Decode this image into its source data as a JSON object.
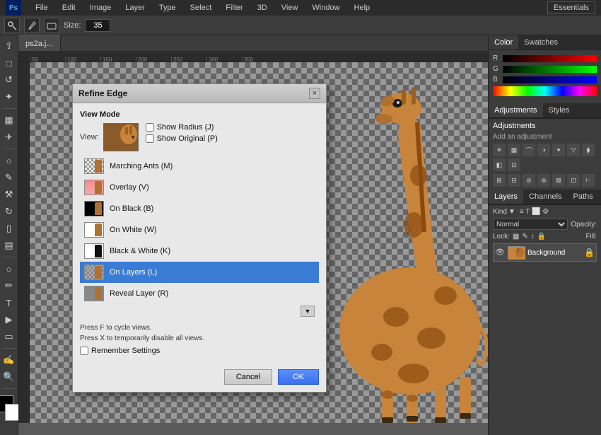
{
  "app": {
    "title": "Adobe Photoshop",
    "essentials_label": "Essentials"
  },
  "menu": {
    "items": [
      "PS",
      "File",
      "Edit",
      "Image",
      "Layer",
      "Type",
      "Select",
      "Filter",
      "3D",
      "View",
      "Window",
      "Help"
    ]
  },
  "options_bar": {
    "size_label": "Size:",
    "size_value": "35"
  },
  "canvas_tab": {
    "label": "ps2a.j..."
  },
  "ruler": {
    "marks": [
      "50",
      "100",
      "150",
      "200",
      "250",
      "300",
      "350"
    ]
  },
  "refine_edge_dialog": {
    "title": "Refine Edge",
    "close_label": "×",
    "view_mode_header": "View Mode",
    "view_label": "View:",
    "show_radius_label": "Show Radius (J)",
    "show_original_label": "Show Original (P)",
    "view_items": [
      {
        "id": "marching",
        "label": "Marching Ants (M)",
        "thumb_class": "thumb-marching"
      },
      {
        "id": "overlay",
        "label": "Overlay (V)",
        "thumb_class": "thumb-overlay"
      },
      {
        "id": "on-black",
        "label": "On Black (B)",
        "thumb_class": "thumb-on-black"
      },
      {
        "id": "on-white",
        "label": "On White (W)",
        "thumb_class": "thumb-on-white"
      },
      {
        "id": "bw",
        "label": "Black & White (K)",
        "thumb_class": "thumb-bw"
      },
      {
        "id": "on-layers",
        "label": "On Layers (L)",
        "thumb_class": "thumb-on-layers",
        "selected": true
      },
      {
        "id": "reveal",
        "label": "Reveal Layer (R)",
        "thumb_class": "thumb-reveal"
      }
    ],
    "hint_line1": "Press F to cycle views.",
    "hint_line2": "Press X to temporarily disable all views.",
    "remember_label": "Remember Settings",
    "cancel_label": "Cancel",
    "ok_label": "OK"
  },
  "right_panel": {
    "color_tab": "Color",
    "swatches_tab": "Swatches",
    "r_label": "R",
    "g_label": "G",
    "b_label": "B",
    "adjustments_tab": "Adjustments",
    "styles_tab": "Styles",
    "add_adjustment_label": "Add an adjustment",
    "layers_tab": "Layers",
    "channels_tab": "Channels",
    "paths_tab": "Paths",
    "kind_label": "Kind",
    "normal_label": "Normal",
    "opacity_label": "Opacity:",
    "lock_label": "Lock:",
    "fill_label": "Fill:",
    "layer_name": "Background"
  }
}
